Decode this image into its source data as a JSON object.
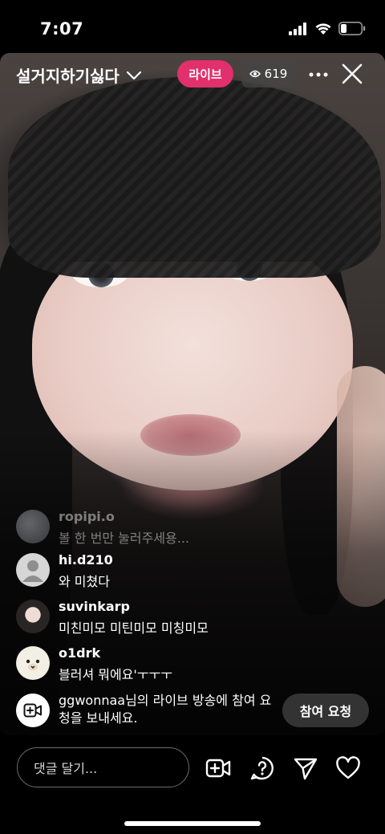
{
  "status_bar": {
    "time": "7:07"
  },
  "header": {
    "username": "설거지하기싫다",
    "live_label": "라이브",
    "viewer_count": "619"
  },
  "comments": [
    {
      "user": "ropipi.o",
      "text": "볼 한 번만 눌러주세용...",
      "avatar": "photo-avatar",
      "faded": true
    },
    {
      "user": "hi.d210",
      "text": "와 미쳤다",
      "avatar": "default-person-avatar"
    },
    {
      "user": "suvinkarp",
      "text": "미친미모 미틴미모 미칭미모",
      "avatar": "photo-avatar"
    },
    {
      "user": "o1drk",
      "text": "블러셔 뭐에요'ㅜㅜㅜ",
      "avatar": "bear-avatar"
    }
  ],
  "join_request": {
    "message": "ggwonnaa님의 라이브 방송에 참여 요청을 보내세요.",
    "button_label": "참여 요청"
  },
  "bottom_bar": {
    "comment_placeholder": "댓글 달기...",
    "icons": [
      "add-video-icon",
      "question-icon",
      "send-icon",
      "heart-icon"
    ]
  }
}
